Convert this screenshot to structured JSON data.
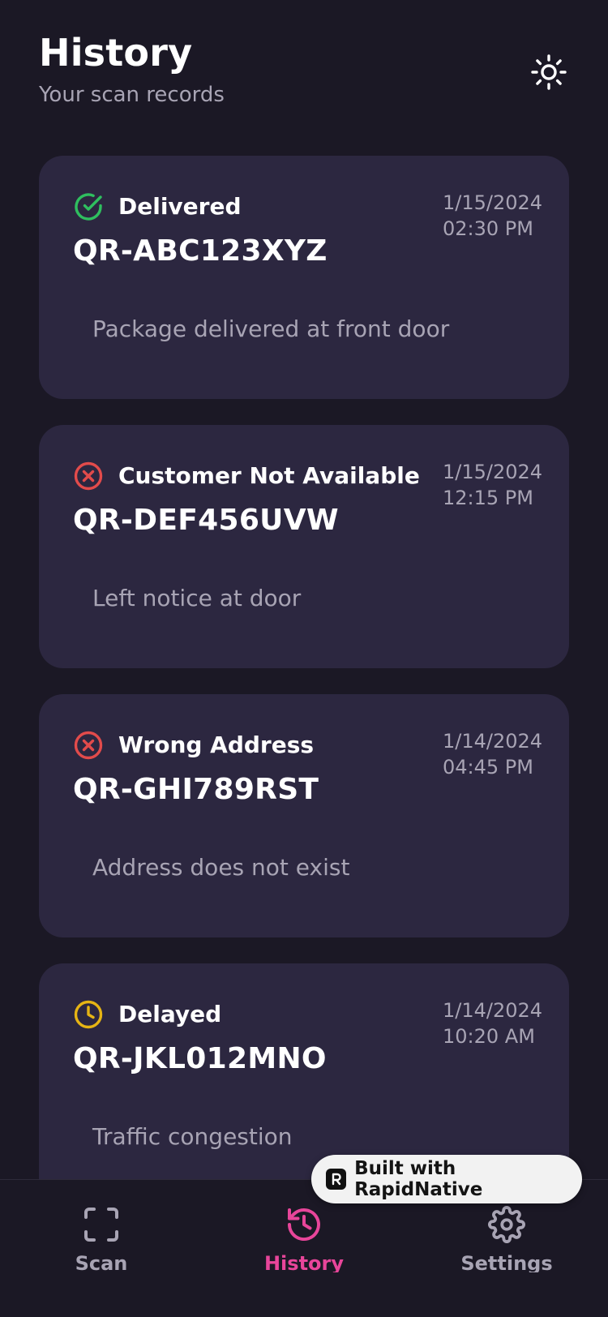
{
  "header": {
    "title": "History",
    "subtitle": "Your scan records"
  },
  "theme_toggle": {
    "icon": "sun-icon"
  },
  "records": [
    {
      "status": "Delivered",
      "status_icon": "check-circle-icon",
      "status_color": "#2fbf5f",
      "date": "1/15/2024",
      "time": "02:30 PM",
      "code": "QR-ABC123XYZ",
      "note": "Package delivered at front door"
    },
    {
      "status": "Customer Not Available",
      "status_icon": "x-circle-icon",
      "status_color": "#e24b4b",
      "date": "1/15/2024",
      "time": "12:15 PM",
      "code": "QR-DEF456UVW",
      "note": "Left notice at door"
    },
    {
      "status": "Wrong Address",
      "status_icon": "x-circle-icon",
      "status_color": "#e24b4b",
      "date": "1/14/2024",
      "time": "04:45 PM",
      "code": "QR-GHI789RST",
      "note": "Address does not exist"
    },
    {
      "status": "Delayed",
      "status_icon": "clock-icon",
      "status_color": "#e6b414",
      "date": "1/14/2024",
      "time": "10:20 AM",
      "code": "QR-JKL012MNO",
      "note": "Traffic congestion"
    }
  ],
  "badge": {
    "label": "Built with RapidNative",
    "logo": "rapidnative-logo"
  },
  "nav": {
    "active_color": "#e8459a",
    "inactive_color": "#a8a4b4",
    "items": [
      {
        "label": "Scan",
        "icon": "scan-frame-icon",
        "active": false
      },
      {
        "label": "History",
        "icon": "history-icon",
        "active": true
      },
      {
        "label": "Settings",
        "icon": "gear-icon",
        "active": false
      }
    ]
  }
}
